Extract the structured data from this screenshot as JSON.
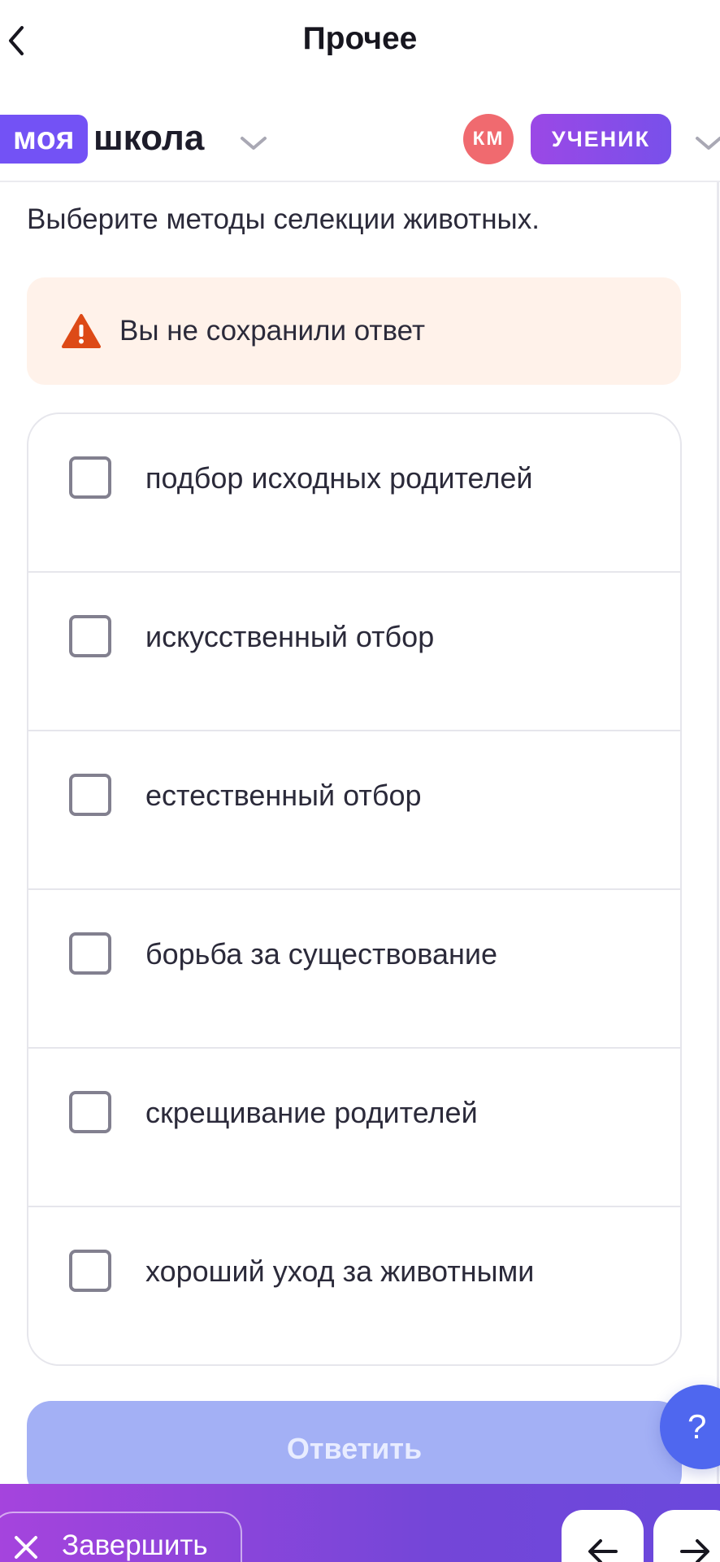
{
  "header": {
    "title": "Прочее",
    "back_icon": "chevron-left-icon"
  },
  "brand": {
    "logo_part1": "моя",
    "logo_part2": "школа",
    "logo_color": "#7352f5",
    "avatar_initials": "КМ",
    "avatar_color": "#f06a6f",
    "role": "УЧЕНИК"
  },
  "question": {
    "text": "Выберите методы селекции животных."
  },
  "warning": {
    "icon": "warning-triangle-icon",
    "text": "Вы не сохранили ответ",
    "background": "#fff2ea",
    "icon_color": "#dd4a17"
  },
  "options": [
    {
      "label": "подбор исходных родителей",
      "checked": false
    },
    {
      "label": "искусственный отбор",
      "checked": false
    },
    {
      "label": "естественный отбор",
      "checked": false
    },
    {
      "label": "борьба за существование",
      "checked": false
    },
    {
      "label": "скрещивание родителей",
      "checked": false
    },
    {
      "label": "хороший уход за животными",
      "checked": false
    }
  ],
  "answer_button": {
    "label": "Ответить",
    "state": "disabled"
  },
  "help": {
    "label": "?"
  },
  "bottom": {
    "finish_label": "Завершить",
    "finish_icon": "close-icon",
    "prev_icon": "arrow-left-icon",
    "next_icon": "arrow-right-icon"
  }
}
